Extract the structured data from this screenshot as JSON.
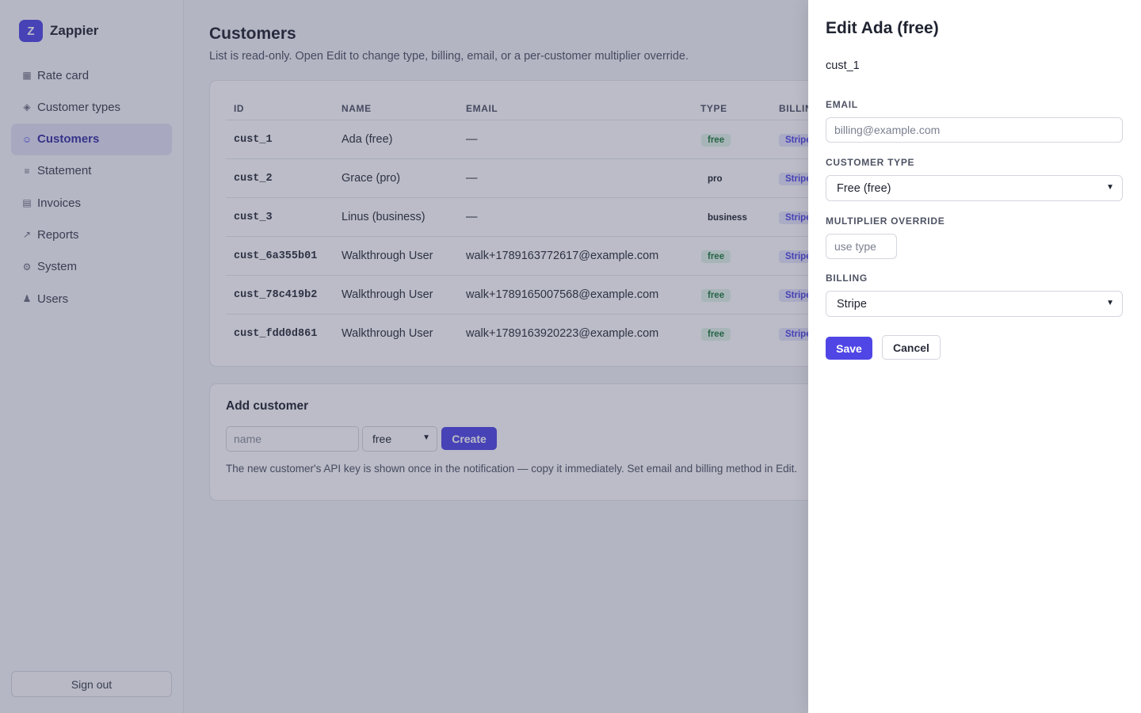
{
  "sidebar": {
    "logo_letter": "Z",
    "brand": "Zappier",
    "items": [
      {
        "label": "Rate card",
        "icon": "▦"
      },
      {
        "label": "Customer types",
        "icon": "◈"
      },
      {
        "label": "Customers",
        "icon": "☺"
      },
      {
        "label": "Statement",
        "icon": "≡"
      },
      {
        "label": "Invoices",
        "icon": "▤"
      },
      {
        "label": "Reports",
        "icon": "↗"
      },
      {
        "label": "System",
        "icon": "⚙"
      },
      {
        "label": "Users",
        "icon": "♟"
      }
    ],
    "active": "Customers",
    "signout_label": "Sign out"
  },
  "main": {
    "title": "Customers",
    "subtitle": "List is read-only. Open Edit to change type, billing, email, or a per-customer multiplier override.",
    "table": {
      "headers": {
        "id": "ID",
        "name": "NAME",
        "email": "EMAIL",
        "type": "TYPE",
        "billing": "BILLING"
      },
      "rows": [
        {
          "id": "cust_1",
          "name": "Ada (free)",
          "email": "—",
          "type": "free",
          "billing": "Stripe"
        },
        {
          "id": "cust_2",
          "name": "Grace (pro)",
          "email": "—",
          "type": "pro",
          "billing": "Stripe"
        },
        {
          "id": "cust_3",
          "name": "Linus (business)",
          "email": "—",
          "type": "business",
          "billing": "Stripe"
        },
        {
          "id": "cust_6a355b01",
          "name": "Walkthrough User",
          "email": "walk+1789163772617@example.com",
          "type": "free",
          "billing": "Stripe"
        },
        {
          "id": "cust_78c419b2",
          "name": "Walkthrough User",
          "email": "walk+1789165007568@example.com",
          "type": "free",
          "billing": "Stripe"
        },
        {
          "id": "cust_fdd0d861",
          "name": "Walkthrough User",
          "email": "walk+1789163920223@example.com",
          "type": "free",
          "billing": "Stripe"
        }
      ]
    },
    "add": {
      "title": "Add customer",
      "name_placeholder": "name",
      "type_value": "free",
      "create_label": "Create",
      "note": "The new customer's API key is shown once in the notification — copy it immediately. Set email and billing method in Edit."
    }
  },
  "drawer": {
    "title": "Edit Ada (free)",
    "customer_id": "cust_1",
    "email_label": "EMAIL",
    "email_placeholder": "billing@example.com",
    "type_label": "CUSTOMER TYPE",
    "type_value": "Free (free)",
    "multiplier_label": "MULTIPLIER OVERRIDE",
    "multiplier_placeholder": "use type",
    "billing_label": "BILLING",
    "billing_value": "Stripe",
    "save_label": "Save",
    "cancel_label": "Cancel"
  },
  "colors": {
    "accent": "#4f46e5",
    "free_badge_bg": "#e3f5e8",
    "free_badge_fg": "#1e7a3c",
    "overlay": "rgba(55,60,90,0.34)"
  }
}
